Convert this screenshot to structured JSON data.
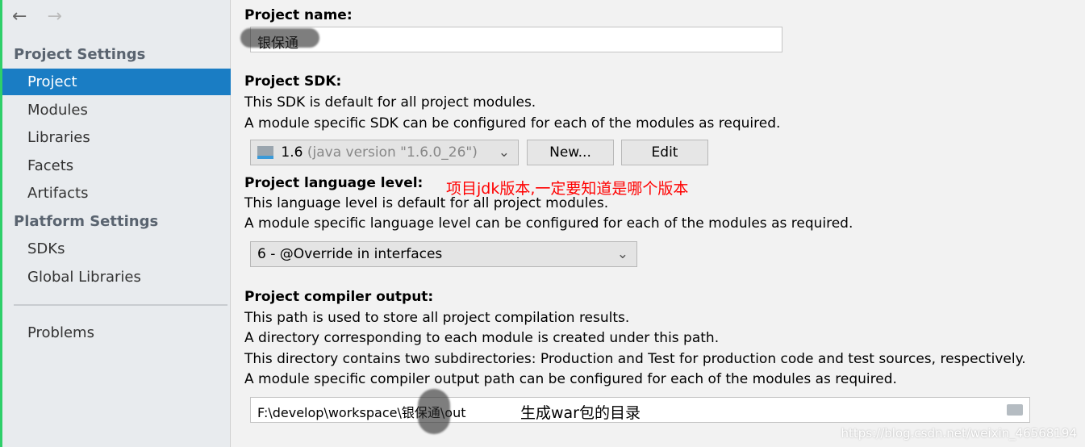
{
  "sidebar": {
    "back_icon": "arrow-left-icon",
    "forward_icon": "arrow-right-icon",
    "project_settings": "Project Settings",
    "project_items": [
      "Project",
      "Modules",
      "Libraries",
      "Facets",
      "Artifacts"
    ],
    "platform_settings": "Platform Settings",
    "platform_items": [
      "SDKs",
      "Global Libraries"
    ],
    "problems": "Problems",
    "selected": "Project"
  },
  "main": {
    "name_label": "Project name:",
    "name_value": "银保通",
    "sdk_label": "Project SDK:",
    "sdk_desc1": "This SDK is default for all project modules.",
    "sdk_desc2": "A module specific SDK can be configured for each of the modules as required.",
    "sdk_version": "1.6",
    "sdk_detail": "(java version \"1.6.0_26\")",
    "new_button": "New...",
    "edit_button": "Edit",
    "lang_label": "Project language level:",
    "lang_annotation": "项目jdk版本,一定要知道是哪个版本",
    "lang_desc1": "This language level is default for all project modules.",
    "lang_desc2": "A module specific language level can be configured for each of the modules as required.",
    "lang_value": "6 - @Override in interfaces",
    "out_label": "Project compiler output:",
    "out_desc1": "This path is used to store all project compilation results.",
    "out_desc2": "A directory corresponding to each module is created under this path.",
    "out_desc3": "This directory contains two subdirectories: Production and Test for production code and test sources, respectively.",
    "out_desc4": "A module specific compiler output path can be configured for each of the modules as required.",
    "out_value": "F:\\develop\\workspace\\银保通\\out",
    "out_annotation": "生成war包的目录"
  },
  "watermark": "https://blog.csdn.net/weixin_46568194",
  "colors": {
    "selection": "#1a7dc4",
    "annotation": "#ff0000"
  }
}
